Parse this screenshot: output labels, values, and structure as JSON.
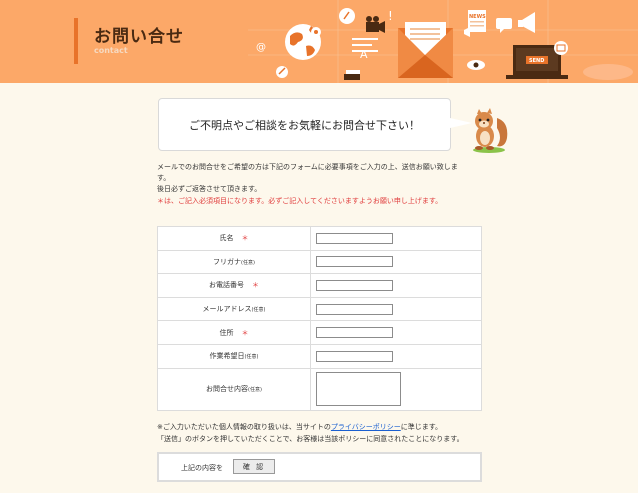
{
  "header": {
    "title": "お問い合せ",
    "subtitle": "contact",
    "illustration_text": {
      "news": "NEWS",
      "send": "SEND"
    }
  },
  "bubble": {
    "text": "ご不明点やご相談をお気軽にお問合せ下さい！"
  },
  "intro": {
    "line1": "メールでのお問合せをご希望の方は下記のフォームに必要事項をご入力の上、送信お願い致しま",
    "line2": "す。",
    "line3": "後日必ずご返答させて頂きます。",
    "required_note": "＊は、ご記入必須項目になります。必ずご記入してくださいますようお願い申し上げます。"
  },
  "form": {
    "rows": [
      {
        "label": "氏名",
        "required": "＊",
        "optional": ""
      },
      {
        "label": "フリガナ",
        "required": "",
        "optional": "(任意)"
      },
      {
        "label": "お電話番号",
        "required": "＊",
        "optional": ""
      },
      {
        "label": "メールアドレス",
        "required": "",
        "optional": "(任意)"
      },
      {
        "label": "住所",
        "required": "＊",
        "optional": ""
      },
      {
        "label": "作業希望日",
        "required": "",
        "optional": "(任意)"
      },
      {
        "label": "お問合せ内容",
        "required": "",
        "optional": "(任意)"
      }
    ]
  },
  "notice": {
    "line1_before": "※ご入力いただいた個人情報の取り扱いは、当サイトの",
    "link": "プライバシーポリシー",
    "line1_after": "に準じます。",
    "line2": "「送信」のボタンを押していただくことで、お客様は当該ポリシーに同意されたことになります。"
  },
  "confirm": {
    "label": "上記の内容を",
    "button": "確 認"
  },
  "colors": {
    "banner": "#fca868",
    "accent": "#e8732a",
    "required": "#e03b3b",
    "link": "#1a5fd0"
  }
}
